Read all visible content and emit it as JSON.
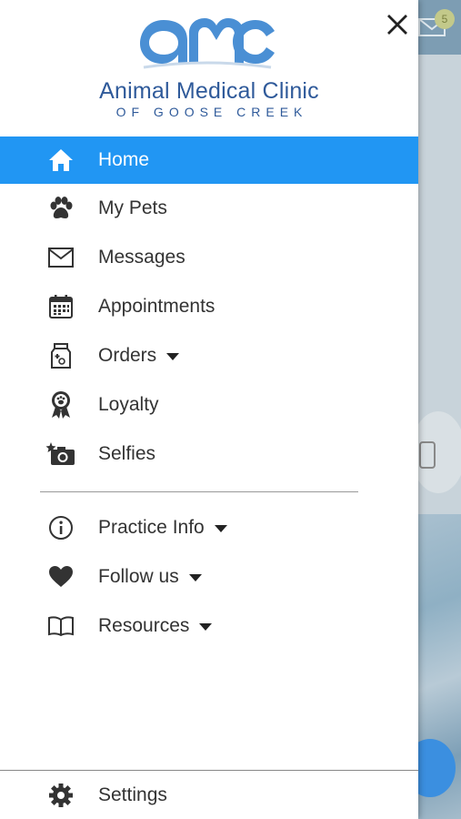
{
  "brand": {
    "logo_letters": "AMC",
    "name": "Animal Medical Clinic",
    "subtitle": "OF GOOSE CREEK",
    "color": "#2f5a9a",
    "accent": "#4a90e2"
  },
  "background": {
    "badge_count": "5"
  },
  "menu": {
    "active_color": "#2196f3",
    "items": [
      {
        "label": "Home",
        "icon": "home-icon"
      },
      {
        "label": "My Pets",
        "icon": "paw-icon"
      },
      {
        "label": "Messages",
        "icon": "envelope-icon"
      },
      {
        "label": "Appointments",
        "icon": "calendar-icon"
      },
      {
        "label": "Orders",
        "icon": "pet-food-bag-icon"
      },
      {
        "label": "Loyalty",
        "icon": "award-ribbon-icon"
      },
      {
        "label": "Selfies",
        "icon": "camera-icon"
      }
    ],
    "secondary": [
      {
        "label": "Practice Info",
        "icon": "info-icon"
      },
      {
        "label": "Follow us",
        "icon": "heart-icon"
      },
      {
        "label": "Resources",
        "icon": "book-icon"
      }
    ],
    "settings": {
      "label": "Settings",
      "icon": "gear-icon"
    }
  }
}
